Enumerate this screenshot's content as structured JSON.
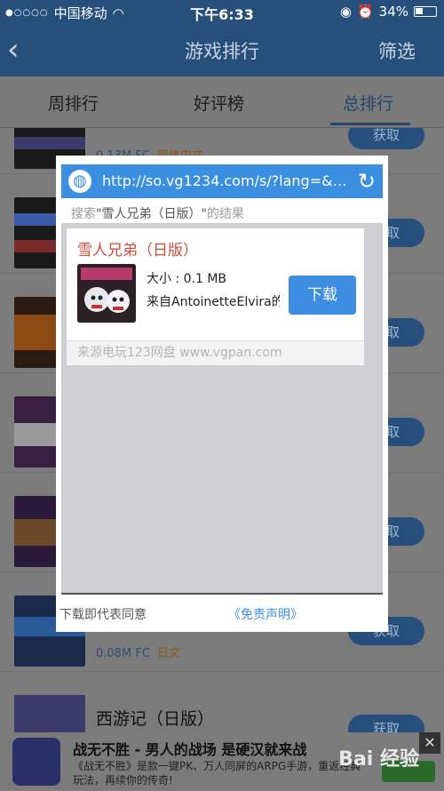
{
  "status": {
    "carrier": "中国移动",
    "time": "下午6:33",
    "battery": "34%"
  },
  "nav": {
    "back_icon": "‹",
    "title": "游戏排行",
    "filter": "筛选"
  },
  "tabs": [
    "周排行",
    "好评榜",
    "总排行"
  ],
  "list": {
    "row1": {
      "size": "0.13M",
      "platform": "FC",
      "lang": "简体中文",
      "btn": "获取"
    },
    "row6": {
      "size": "0.08M",
      "platform": "FC",
      "lang": "日文",
      "btn": "获取"
    },
    "row7": {
      "title": "西游记（日版）",
      "btn": "获取"
    },
    "btn": "获取"
  },
  "modal": {
    "url": "http://so.vg1234.com/s/?lang=&key...",
    "search_prefix": "搜索",
    "search_query": "\"雪人兄弟（日版）\"",
    "search_suffix": "的结果",
    "result": {
      "name": "雪人兄弟（日版）",
      "size": "大小 : 0.1 MB",
      "source": "来自AntoinetteElvira的",
      "download": "下载",
      "footer": "来源电玩123网盘   www.vgpan.com"
    },
    "agree": "下载即代表同意",
    "disclaimer": "《免责声明》"
  },
  "ad": {
    "title": "战无不胜 - 男人的战场 是硬汉就来战",
    "desc": "《战无不胜》是款一键PK、万人同屏的ARPG手游，重返经典玩法，再续你的传奇!",
    "close": "✕"
  },
  "watermark": "Bai 经验"
}
